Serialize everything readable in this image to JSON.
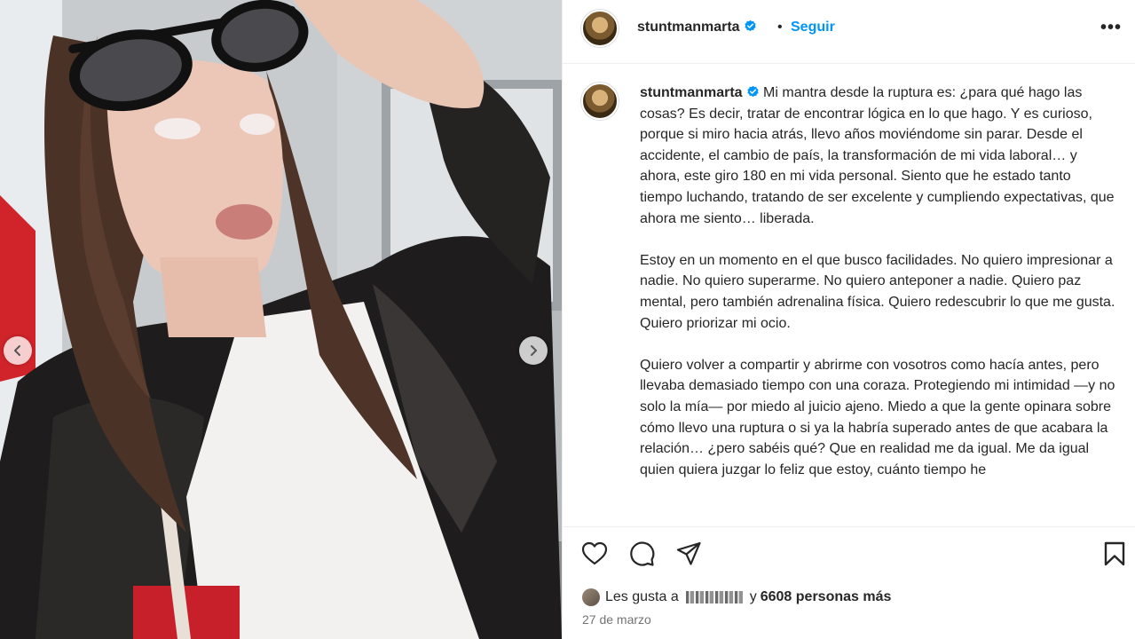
{
  "post": {
    "username": "stuntmanmarta",
    "separator": "•",
    "follow_label": "Seguir",
    "more_label": "•••",
    "caption_paragraphs": [
      "Mi mantra desde la ruptura es: ¿para qué hago las cosas? Es decir, tratar de encontrar lógica en lo que hago. Y es curioso, porque si miro hacia atrás, llevo años moviéndome sin parar. Desde el accidente, el cambio de país, la transformación de mi vida laboral… y ahora, este giro 180 en mi vida personal. Siento que he estado tanto tiempo luchando, tratando de ser excelente y cumpliendo expectativas, que ahora me siento… liberada.",
      "Estoy en un momento en el que busco facilidades. No quiero impresionar a nadie. No quiero superarme. No quiero anteponer a nadie. Quiero paz mental, pero también adrenalina física. Quiero redescubrir lo que me gusta. Quiero priorizar mi ocio.",
      "Quiero volver a compartir y abrirme con vosotros como hacía antes, pero llevaba demasiado tiempo con una coraza. Protegiendo mi intimidad —y no solo la mía— por miedo al juicio ajeno. Miedo a que la gente opinara sobre cómo llevo una ruptura o si ya la habría superado antes de que acabara la relación… ¿pero sabéis qué? Que en realidad me da igual. Me da igual quien quiera juzgar lo feliz que estoy, cuánto tiempo he"
    ],
    "likes_prefix": "Les gusta a",
    "likes_connector": "y",
    "likes_count": "6608 personas más",
    "date": "27 de marzo"
  },
  "icons": {
    "verified": "verified-badge-icon",
    "like": "heart-icon",
    "comment": "comment-icon",
    "share": "send-icon",
    "save": "bookmark-icon",
    "prev": "chevron-left-icon",
    "next": "chevron-right-icon"
  },
  "colors": {
    "link": "#0095f6",
    "text": "#262626",
    "muted": "#737373",
    "verified": "#0095f6"
  }
}
